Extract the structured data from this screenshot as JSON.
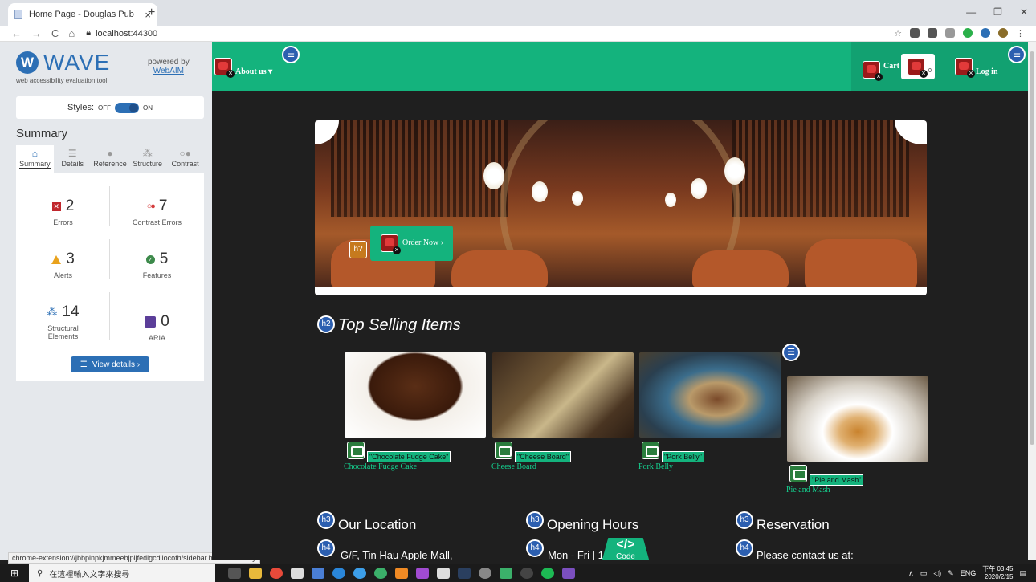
{
  "browser": {
    "tab_title": "Home Page - Douglas Pub",
    "tab_close": "×",
    "new_tab": "+",
    "url": "localhost:44300",
    "status_url": "chrome-extension://jbbplnpkjmmeebjpijfedlgcdilocofh/sidebar.html#summary"
  },
  "wave": {
    "logo_letter": "W",
    "logo_word": "WAVE",
    "subtitle": "web accessibility evaluation tool",
    "powered_by": "powered by",
    "webaim": "WebAIM",
    "styles_label": "Styles:",
    "styles_off": "OFF",
    "styles_on": "ON",
    "summary_heading": "Summary",
    "tabs": [
      {
        "label": "Summary",
        "icon": "home-icon"
      },
      {
        "label": "Details",
        "icon": "list-icon"
      },
      {
        "label": "Reference",
        "icon": "info-icon"
      },
      {
        "label": "Structure",
        "icon": "structure-icon"
      },
      {
        "label": "Contrast",
        "icon": "contrast-icon"
      }
    ],
    "stats": {
      "errors": {
        "value": "2",
        "label": "Errors"
      },
      "contrast": {
        "value": "7",
        "label": "Contrast Errors"
      },
      "alerts": {
        "value": "3",
        "label": "Alerts"
      },
      "features": {
        "value": "5",
        "label": "Features"
      },
      "structural": {
        "value": "14",
        "label": "Structural Elements"
      },
      "aria": {
        "value": "0",
        "label": "ARIA"
      }
    },
    "view_details": "View details ›"
  },
  "site": {
    "about": "About us ▾",
    "cart": "Cart",
    "cart_count": "0",
    "login": "Log in",
    "order_now": "Order Now ›",
    "top_selling": "Top Selling Items",
    "items": [
      {
        "alt": "\"Chocolate Fudge Cake\"",
        "caption": "Chocolate Fudge Cake"
      },
      {
        "alt": "\"Cheese Board\"",
        "caption": "Cheese Board"
      },
      {
        "alt": "\"Pork Belly\"",
        "caption": "Pork Belly"
      },
      {
        "alt": "\"Pie and Mash\"",
        "caption": "Pie and Mash"
      }
    ],
    "badges": {
      "h2": "h2",
      "h3": "h3",
      "h4": "h4",
      "alert": "h?"
    },
    "sections": [
      {
        "heading": "Our Location",
        "text": "G/F, Tin Hau Apple Mall,"
      },
      {
        "heading": "Opening Hours",
        "text": "Mon - Fri | 1"
      },
      {
        "heading": "Reservation",
        "text": "Please contact us at:"
      }
    ],
    "code_label": "Code",
    "code_symbol": "</>"
  },
  "taskbar": {
    "search_placeholder": "在這裡輸入文字來搜尋",
    "lang": "ENG",
    "time": "下午 03:45",
    "date": "2020/2/15"
  },
  "colors": {
    "nav_green": "#14b37d",
    "wave_blue": "#2c6fb5",
    "page_bg": "#1f1f1f"
  }
}
